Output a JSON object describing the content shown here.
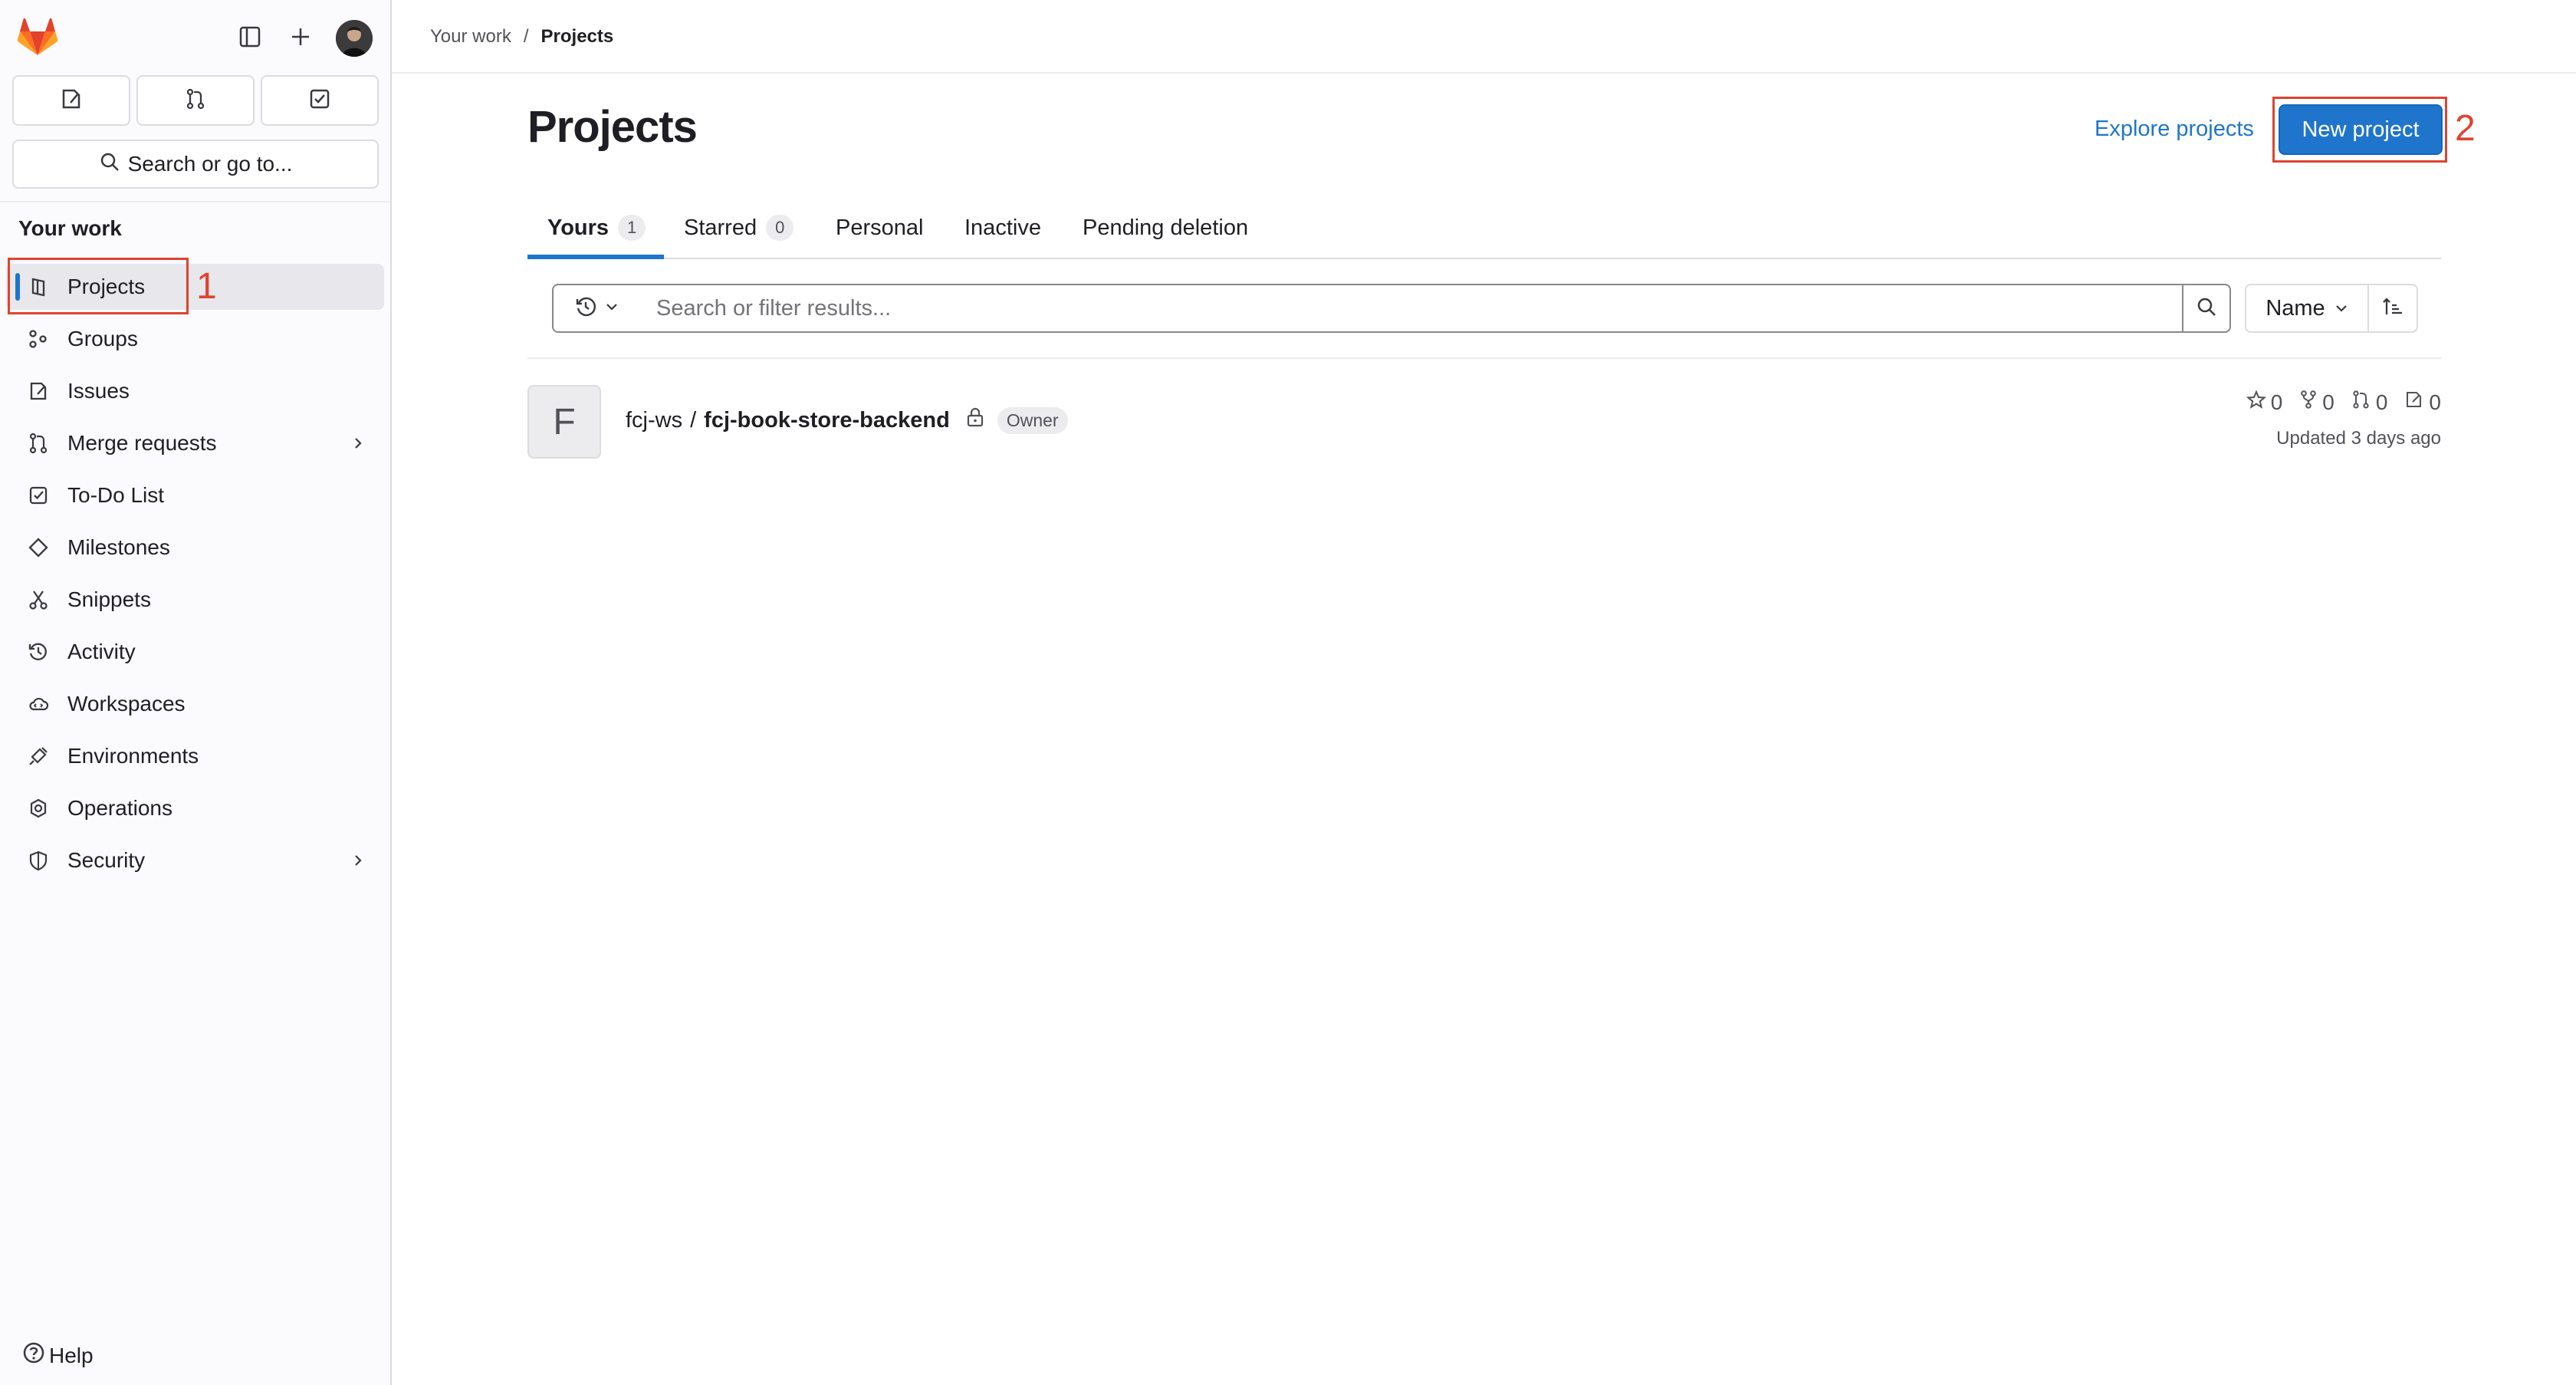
{
  "sidebar": {
    "search_label": "Search or go to...",
    "section_title": "Your work",
    "items": [
      {
        "label": "Projects",
        "icon": "project-icon",
        "active": true
      },
      {
        "label": "Groups",
        "icon": "group-icon"
      },
      {
        "label": "Issues",
        "icon": "issues-icon"
      },
      {
        "label": "Merge requests",
        "icon": "merge-request-icon",
        "chevron": true
      },
      {
        "label": "To-Do List",
        "icon": "todo-icon"
      },
      {
        "label": "Milestones",
        "icon": "milestone-icon"
      },
      {
        "label": "Snippets",
        "icon": "snippet-icon"
      },
      {
        "label": "Activity",
        "icon": "history-icon"
      },
      {
        "label": "Workspaces",
        "icon": "workspace-icon"
      },
      {
        "label": "Environments",
        "icon": "environment-icon"
      },
      {
        "label": "Operations",
        "icon": "operations-icon"
      },
      {
        "label": "Security",
        "icon": "shield-icon",
        "chevron": true
      }
    ],
    "help_label": "Help"
  },
  "breadcrumb": {
    "parent": "Your work",
    "separator": "/",
    "current": "Projects"
  },
  "header": {
    "title": "Projects",
    "explore_label": "Explore projects",
    "new_project_label": "New project"
  },
  "tabs": [
    {
      "label": "Yours",
      "count": "1",
      "active": true
    },
    {
      "label": "Starred",
      "count": "0"
    },
    {
      "label": "Personal"
    },
    {
      "label": "Inactive"
    },
    {
      "label": "Pending deletion"
    }
  ],
  "filter": {
    "placeholder": "Search or filter results...",
    "sort_label": "Name"
  },
  "projects": [
    {
      "avatar_letter": "F",
      "namespace": "fcj-ws",
      "separator": "/",
      "name": "fcj-book-store-backend",
      "role": "Owner",
      "stars": "0",
      "forks": "0",
      "merge_requests": "0",
      "issues": "0",
      "updated": "Updated 3 days ago"
    }
  ],
  "annotations": {
    "one": "1",
    "two": "2"
  },
  "colors": {
    "accent": "#1f75cb",
    "annotation": "#e0432f",
    "logo": "#e24329"
  }
}
